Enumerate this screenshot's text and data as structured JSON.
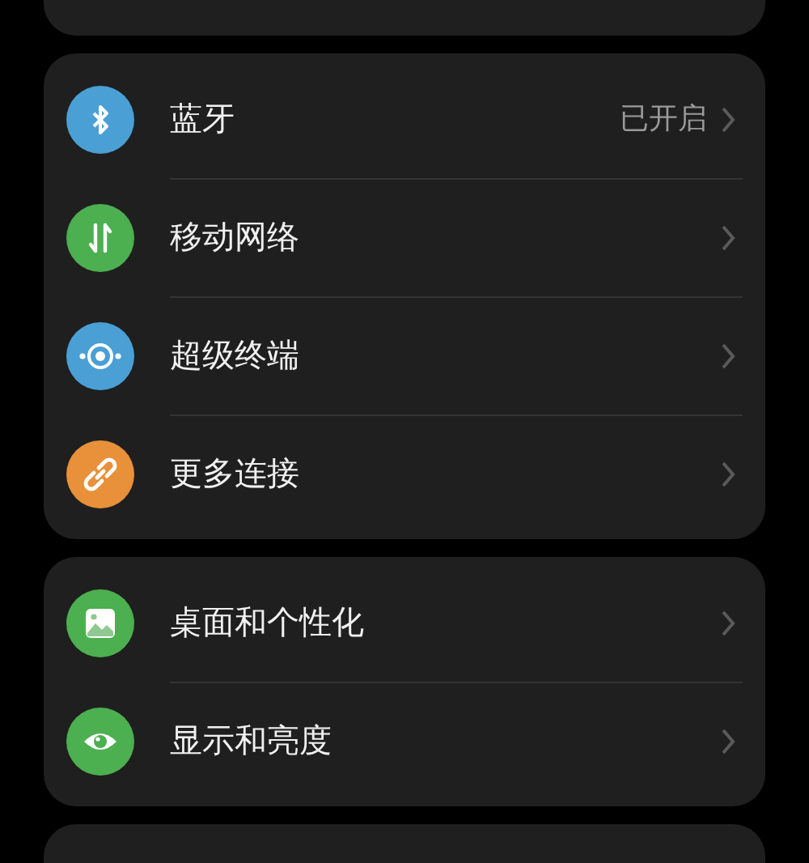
{
  "groups": [
    {
      "items": [
        {
          "kind": "bluetooth",
          "color": "#4a9fd5",
          "label": "蓝牙",
          "value": "已开启"
        },
        {
          "kind": "transfer",
          "color": "#4caf50",
          "label": "移动网络"
        },
        {
          "kind": "device",
          "color": "#4a9fd5",
          "label": "超级终端"
        },
        {
          "kind": "link",
          "color": "#e8903a",
          "label": "更多连接"
        }
      ]
    },
    {
      "items": [
        {
          "kind": "image",
          "color": "#4caf50",
          "label": "桌面和个性化"
        },
        {
          "kind": "eye",
          "color": "#4caf50",
          "label": "显示和亮度"
        }
      ]
    }
  ]
}
